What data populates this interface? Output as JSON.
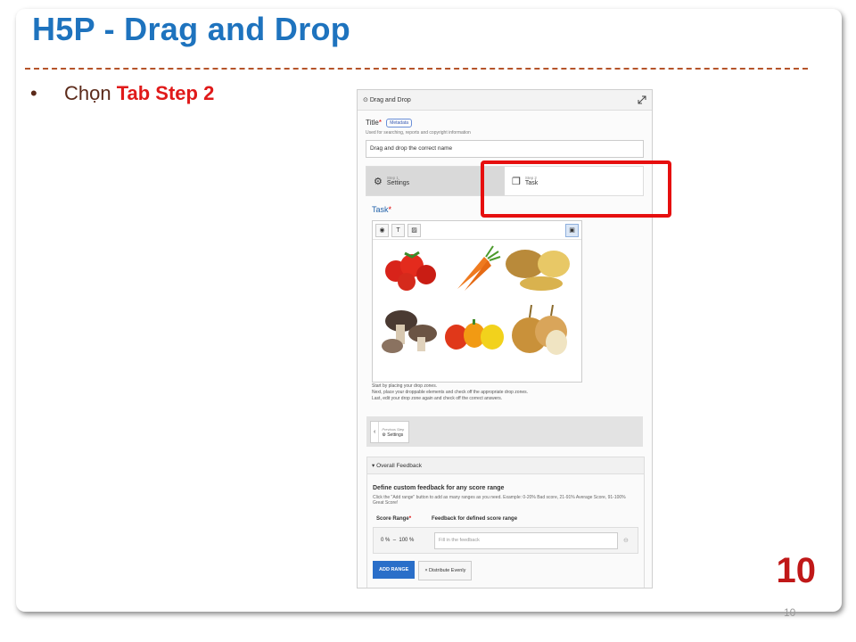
{
  "slide": {
    "title": "H5P - Drag and Drop",
    "bullet_prefix": "Chọn ",
    "bullet_strong": "Tab Step 2",
    "page_number_big": "10",
    "page_number_small": "10"
  },
  "editor": {
    "header_label": "Drag and Drop",
    "title_label": "Title",
    "required_mark": "*",
    "metadata_button": "Metadata",
    "title_help": "Used for searching, reports and copyright information",
    "title_value": "Drag and drop the correct name",
    "steps": [
      {
        "sub": "Step 1",
        "label": "Settings",
        "icon": "gear-icon"
      },
      {
        "sub": "Step 2",
        "label": "Task",
        "icon": "copy-icon"
      }
    ],
    "task_label": "Task",
    "toolbar": [
      "target-icon",
      "T",
      "image-icon",
      "paste-icon"
    ],
    "instructions": [
      "Start by placing your drop zones.",
      "Next, place your droppable elements and check off the appropriate drop zones.",
      "Last, edit your drop zone again and check off the correct answers."
    ],
    "prev_step_small": "Previous Step",
    "prev_step_label": "⚙ Settings",
    "feedback_header": "▾ Overall Feedback",
    "feedback_title": "Define custom feedback for any score range",
    "feedback_desc": "Click the \"Add range\" button to add as many ranges as you need. Example: 0-20% Bad score, 21-91% Average Score, 91-100% Great Score!",
    "col_score_range": "Score Range",
    "col_feedback": "Feedback for defined score range",
    "range_from": "0 %",
    "range_sep": "–",
    "range_to": "100 %",
    "feedback_placeholder": "Fill in the feedback",
    "add_range_label": "ADD RANGE",
    "distribute_label": "× Distribute Evenly"
  },
  "colors": {
    "title_blue": "#1e73be",
    "highlight_red": "#e60f0f",
    "bullet_strong": "#e01a1a",
    "add_range_blue": "#2a6fc9"
  }
}
